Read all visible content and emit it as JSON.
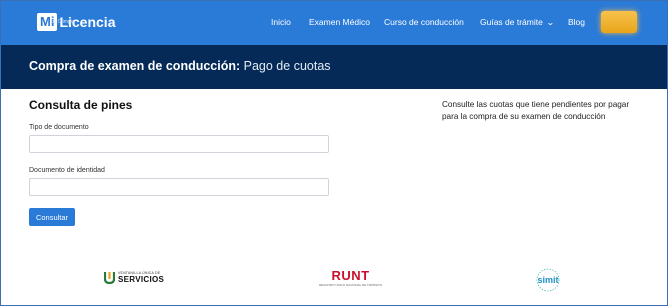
{
  "header": {
    "logo_mi": "Mi",
    "logo_licencia": "Licencia",
    "logo_sub": "by Olimpia",
    "nav": [
      {
        "label": "Inicio"
      },
      {
        "label": "Examen Médico"
      },
      {
        "label": "Curso de conducción"
      },
      {
        "label": "Guías de trámite"
      },
      {
        "label": "Blog"
      }
    ],
    "accent": "#2a7ad8"
  },
  "band": {
    "title_bold": "Compra de examen de conducción:",
    "title_light": " Pago de cuotas",
    "color": "#052a57"
  },
  "form": {
    "title": "Consulta de pines",
    "doc_type_label": "Tipo de documento",
    "doc_type_value": "",
    "doc_id_label": "Documento de identidad",
    "doc_id_value": "",
    "submit_label": "Consultar"
  },
  "aside": {
    "text": "Consulte las cuotas que tiene pendientes por pagar para la compra de su examen de conducción"
  },
  "partners": {
    "vus_small": "VENTANILLA ÚNICA DE",
    "vus_big": "SERVICIOS",
    "runt_big": "RUNT",
    "runt_small": "REGISTRO ÚNICO NACIONAL DE TRÁNSITO",
    "simit": "simit"
  }
}
